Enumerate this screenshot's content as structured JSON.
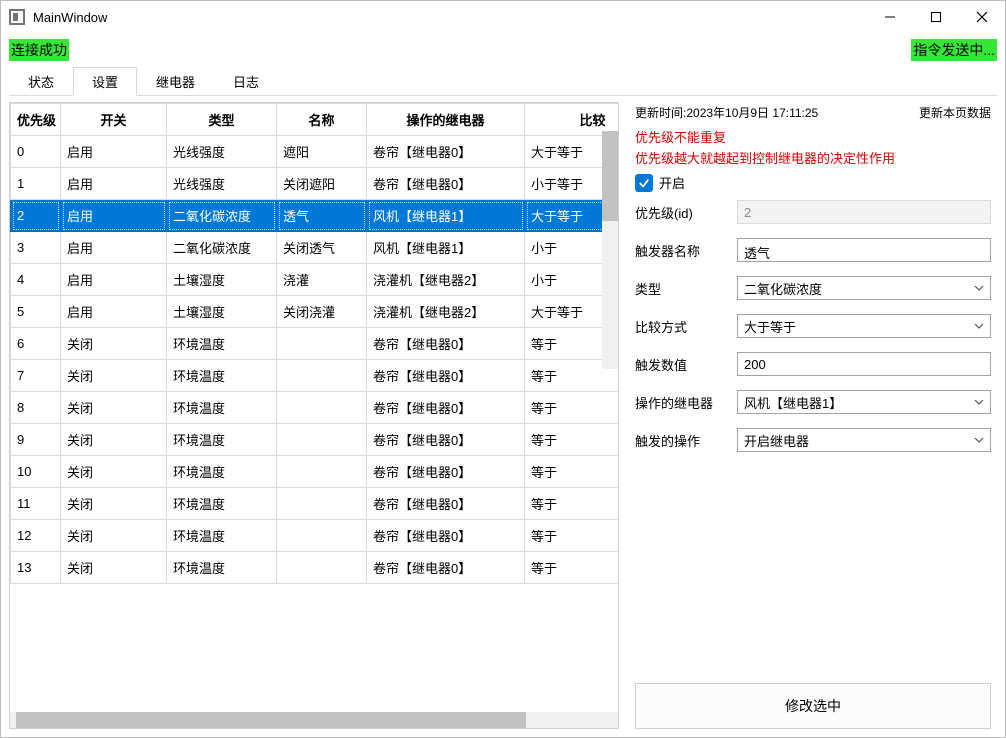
{
  "window": {
    "title": "MainWindow"
  },
  "status": {
    "connection": "连接成功",
    "sending": "指令发送中..."
  },
  "tabs": {
    "items": [
      "状态",
      "设置",
      "继电器",
      "日志"
    ],
    "active_index": 1
  },
  "table": {
    "headers": [
      "优先级",
      "开关",
      "类型",
      "名称",
      "操作的继电器",
      "比较"
    ],
    "selected_index": 2,
    "rows": [
      {
        "priority": "0",
        "switch": "启用",
        "type": "光线强度",
        "name": "遮阳",
        "relay": "卷帘【继电器0】",
        "compare": "大于等于"
      },
      {
        "priority": "1",
        "switch": "启用",
        "type": "光线强度",
        "name": "关闭遮阳",
        "relay": "卷帘【继电器0】",
        "compare": "小于等于"
      },
      {
        "priority": "2",
        "switch": "启用",
        "type": "二氧化碳浓度",
        "name": "透气",
        "relay": "风机【继电器1】",
        "compare": "大于等于"
      },
      {
        "priority": "3",
        "switch": "启用",
        "type": "二氧化碳浓度",
        "name": "关闭透气",
        "relay": "风机【继电器1】",
        "compare": "小于"
      },
      {
        "priority": "4",
        "switch": "启用",
        "type": "土壤湿度",
        "name": "浇灌",
        "relay": "浇灌机【继电器2】",
        "compare": "小于"
      },
      {
        "priority": "5",
        "switch": "启用",
        "type": "土壤湿度",
        "name": "关闭浇灌",
        "relay": "浇灌机【继电器2】",
        "compare": "大于等于"
      },
      {
        "priority": "6",
        "switch": "关闭",
        "type": "环境温度",
        "name": "",
        "relay": "卷帘【继电器0】",
        "compare": "等于"
      },
      {
        "priority": "7",
        "switch": "关闭",
        "type": "环境温度",
        "name": "",
        "relay": "卷帘【继电器0】",
        "compare": "等于"
      },
      {
        "priority": "8",
        "switch": "关闭",
        "type": "环境温度",
        "name": "",
        "relay": "卷帘【继电器0】",
        "compare": "等于"
      },
      {
        "priority": "9",
        "switch": "关闭",
        "type": "环境温度",
        "name": "",
        "relay": "卷帘【继电器0】",
        "compare": "等于"
      },
      {
        "priority": "10",
        "switch": "关闭",
        "type": "环境温度",
        "name": "",
        "relay": "卷帘【继电器0】",
        "compare": "等于"
      },
      {
        "priority": "11",
        "switch": "关闭",
        "type": "环境温度",
        "name": "",
        "relay": "卷帘【继电器0】",
        "compare": "等于"
      },
      {
        "priority": "12",
        "switch": "关闭",
        "type": "环境温度",
        "name": "",
        "relay": "卷帘【继电器0】",
        "compare": "等于"
      },
      {
        "priority": "13",
        "switch": "关闭",
        "type": "环境温度",
        "name": "",
        "relay": "卷帘【继电器0】",
        "compare": "等于"
      }
    ]
  },
  "detail": {
    "update_label": "更新时间:",
    "update_time": "2023年10月9日 17:11:25",
    "refresh_button": "更新本页数据",
    "warning1": "优先级不能重复",
    "warning2": "优先级越大就越起到控制继电器的决定性作用",
    "enable_checked": true,
    "enable_label": "开启",
    "fields": {
      "priority_label": "优先级(id)",
      "priority_value": "2",
      "name_label": "触发器名称",
      "name_value": "透气",
      "type_label": "类型",
      "type_value": "二氧化碳浓度",
      "compare_label": "比较方式",
      "compare_value": "大于等于",
      "threshold_label": "触发数值",
      "threshold_value": "200",
      "relay_label": "操作的继电器",
      "relay_value": "风机【继电器1】",
      "action_label": "触发的操作",
      "action_value": "开启继电器"
    },
    "submit_label": "修改选中"
  }
}
